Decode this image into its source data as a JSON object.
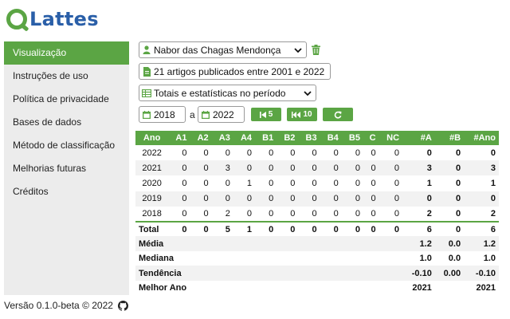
{
  "app": {
    "logo_text": "Lattes"
  },
  "sidebar": {
    "items": [
      {
        "label": "Visualização",
        "active": true
      },
      {
        "label": "Instruções de uso"
      },
      {
        "label": "Política de privacidade"
      },
      {
        "label": "Bases de dados"
      },
      {
        "label": "Método de classificação"
      },
      {
        "label": "Melhorias futuras"
      },
      {
        "label": "Créditos"
      }
    ]
  },
  "footer": {
    "text": "Versão 0.1.0-beta © 2022",
    "icon": "github-icon"
  },
  "controls": {
    "researcher": "Nabor das Chagas Mendonça",
    "summary": "21 artigos publicados entre 2001 e 2022",
    "view": "Totais e estatísticas no período",
    "year_from": "2018",
    "year_sep": "a",
    "year_to": "2022",
    "btn_back5": "5",
    "btn_back10": "10"
  },
  "table": {
    "headers": [
      "Ano",
      "A1",
      "A2",
      "A3",
      "A4",
      "B1",
      "B2",
      "B3",
      "B4",
      "B5",
      "C",
      "NC",
      "#A",
      "#B",
      "#Ano"
    ],
    "rows": [
      [
        "2022",
        "0",
        "0",
        "0",
        "0",
        "0",
        "0",
        "0",
        "0",
        "0",
        "0",
        "0",
        "0",
        "0",
        "0"
      ],
      [
        "2021",
        "0",
        "0",
        "3",
        "0",
        "0",
        "0",
        "0",
        "0",
        "0",
        "0",
        "0",
        "3",
        "0",
        "3"
      ],
      [
        "2020",
        "0",
        "0",
        "0",
        "1",
        "0",
        "0",
        "0",
        "0",
        "0",
        "0",
        "0",
        "1",
        "0",
        "1"
      ],
      [
        "2019",
        "0",
        "0",
        "0",
        "0",
        "0",
        "0",
        "0",
        "0",
        "0",
        "0",
        "0",
        "0",
        "0",
        "0"
      ],
      [
        "2018",
        "0",
        "0",
        "2",
        "0",
        "0",
        "0",
        "0",
        "0",
        "0",
        "0",
        "0",
        "2",
        "0",
        "2"
      ]
    ],
    "total": {
      "label": "Total",
      "values": [
        "0",
        "0",
        "5",
        "1",
        "0",
        "0",
        "0",
        "0",
        "0",
        "0",
        "0",
        "6",
        "0",
        "6"
      ]
    },
    "stats": [
      {
        "label": "Média",
        "values": [
          "1.2",
          "0.0",
          "1.2"
        ]
      },
      {
        "label": "Mediana",
        "values": [
          "1.0",
          "0.0",
          "1.0"
        ]
      },
      {
        "label": "Tendência",
        "values": [
          "-0.10",
          "0.00",
          "-0.10"
        ]
      },
      {
        "label": "Melhor Ano",
        "values": [
          "2021",
          "",
          "2021"
        ]
      }
    ]
  },
  "colors": {
    "accent": "#5ba544",
    "brand_blue": "#2a5fa8"
  }
}
